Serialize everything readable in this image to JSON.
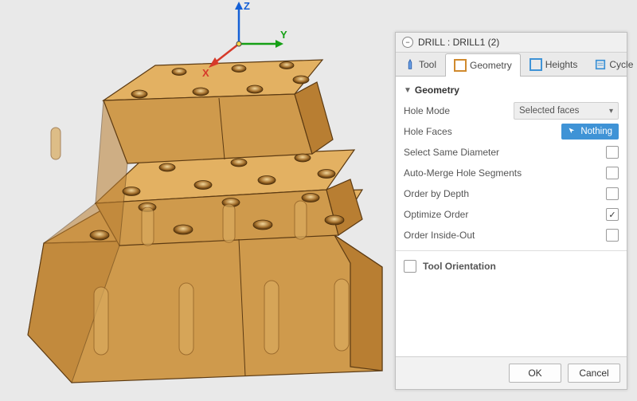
{
  "panel": {
    "title": "DRILL : DRILL1 (2)",
    "tabs": [
      {
        "label": "Tool"
      },
      {
        "label": "Geometry"
      },
      {
        "label": "Heights"
      },
      {
        "label": "Cycle"
      }
    ],
    "active_tab": 1,
    "group": {
      "title": "Geometry",
      "rows": {
        "hole_mode": {
          "label": "Hole Mode",
          "value": "Selected faces"
        },
        "hole_faces": {
          "label": "Hole Faces",
          "value": "Nothing"
        },
        "same_dia": {
          "label": "Select Same Diameter",
          "checked": false
        },
        "auto_merge": {
          "label": "Auto-Merge Hole Segments",
          "checked": false
        },
        "order_depth": {
          "label": "Order by Depth",
          "checked": false
        },
        "optimize": {
          "label": "Optimize Order",
          "checked": true
        },
        "inside_out": {
          "label": "Order Inside-Out",
          "checked": false
        }
      }
    },
    "group2": {
      "title": "Tool Orientation",
      "checked": false
    },
    "footer": {
      "ok": "OK",
      "cancel": "Cancel"
    }
  },
  "axes": {
    "x": "X",
    "y": "Y",
    "z": "Z"
  },
  "colors": {
    "panel_accent": "#3f93d6",
    "model_top": "#e3b162",
    "model_side": "#cf9a4c",
    "model_front": "#b87e32",
    "edge": "#5c3a12"
  }
}
